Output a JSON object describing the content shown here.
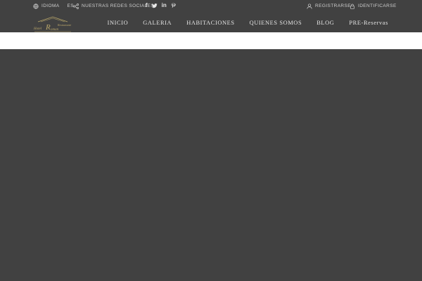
{
  "topbar": {
    "language_label": "IDIOMA",
    "language_value": "ES",
    "social_label": "NUESTRAS REDES SOCIALES",
    "social_icons": [
      "facebook-icon",
      "twitter-icon",
      "linkedin-icon",
      "pinterest-icon"
    ],
    "register_label": "REGISTRARSE",
    "login_label": "IDENTIFICARSE"
  },
  "nav": {
    "items": [
      {
        "label": "INICIO"
      },
      {
        "label": "GALERIA"
      },
      {
        "label": "HABITACIONES"
      },
      {
        "label": "QUIENES SOMOS"
      },
      {
        "label": "BLOG"
      },
      {
        "label": "PRE-Reservas"
      }
    ]
  },
  "colors": {
    "header_bg": "#414141",
    "band_bg": "#ffffff",
    "logo_gold": "#b9a66a",
    "text": "#e6e6e6"
  }
}
